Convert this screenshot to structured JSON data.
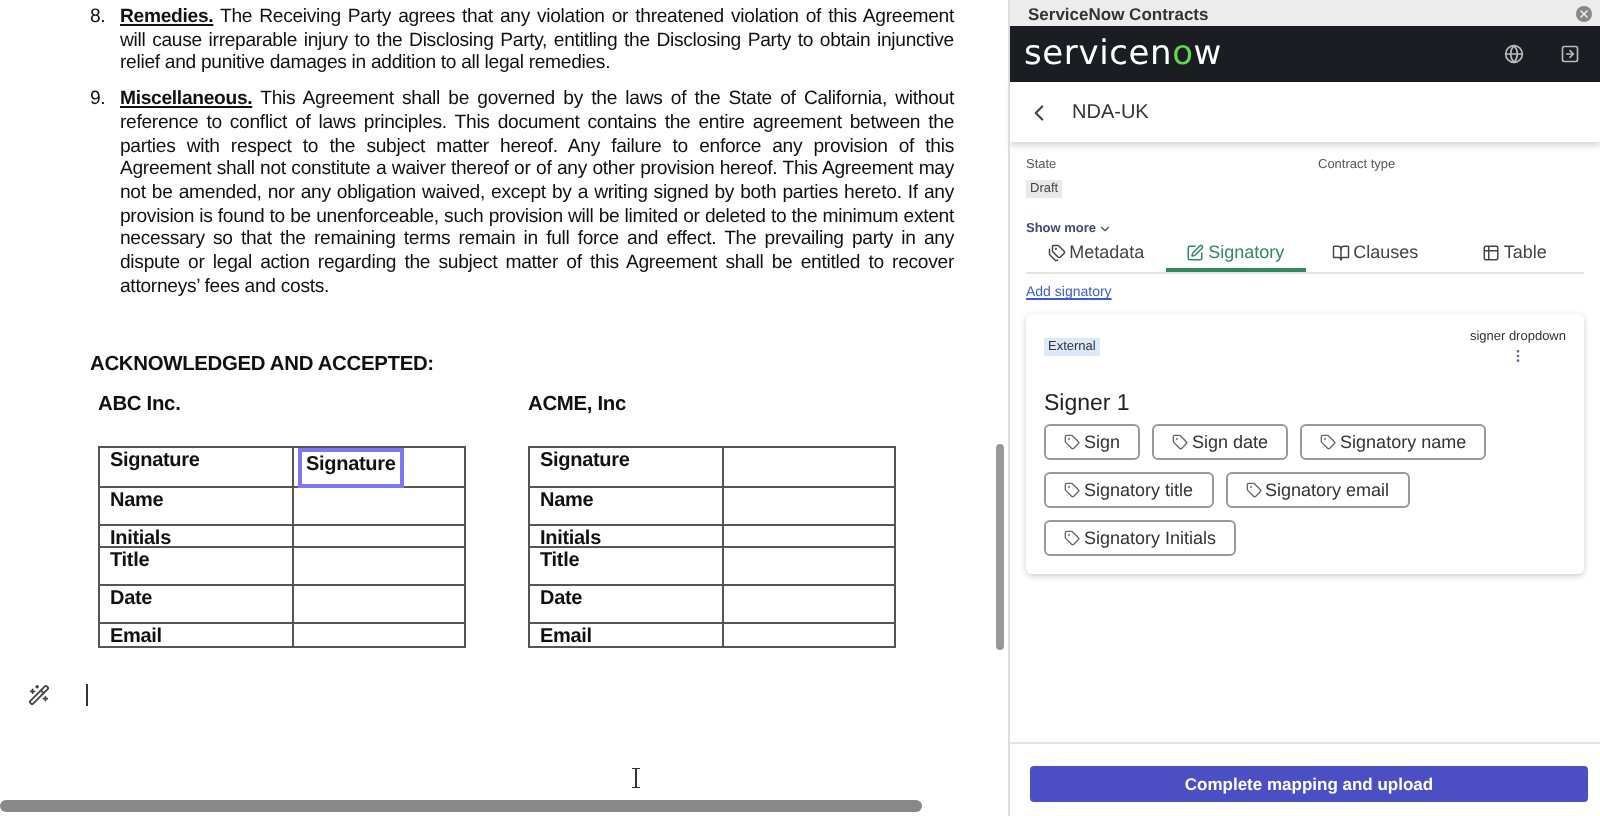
{
  "document": {
    "clauses": [
      {
        "number": "8.",
        "heading": "Remedies.",
        "text": "The Receiving Party agrees that any violation or threatened violation of this Agreement will cause irreparable injury to the Disclosing Party, entitling the Disclosing Party to obtain injunctive relief and punitive damages in addition to all legal remedies."
      },
      {
        "number": "9.",
        "heading": "Miscellaneous.",
        "text": "This Agreement shall be governed by the laws of the State of California, without reference to conflict of laws principles.  This document contains the entire agreement between the parties with respect to the subject matter hereof.  Any failure to enforce any provision of this Agreement shall not constitute a waiver thereof or of any other provision hereof.  This Agreement may not be amended, nor any obligation waived, except by a writing signed by both parties hereto. If any provision is found to be unenforceable, such provision will be limited or deleted to the minimum extent necessary so that the remaining terms remain in full force and effect. The prevailing party in any dispute or legal action regarding the subject matter of this Agreement shall be entitled to recover attorneys’ fees and costs."
      }
    ],
    "acknowledgement": "ACKNOWLEDGED AND ACCEPTED:",
    "parties": [
      {
        "name": "ABC Inc.",
        "rows": [
          {
            "label": "Signature",
            "value": {
              "text": "Signature",
              "selected": true
            }
          },
          {
            "label": "Name"
          },
          {
            "label": "Initials"
          },
          {
            "label": "Title"
          },
          {
            "label": "Date"
          },
          {
            "label": "Email"
          }
        ]
      },
      {
        "name": "ACME, Inc",
        "rows": [
          {
            "label": "Signature"
          },
          {
            "label": "Name"
          },
          {
            "label": "Initials"
          },
          {
            "label": "Title"
          },
          {
            "label": "Date"
          },
          {
            "label": "Email"
          }
        ]
      }
    ]
  },
  "panel": {
    "window_title": "ServiceNow Contracts",
    "logo": {
      "text_a": "servicen",
      "text_o": "o",
      "text_b": "w"
    },
    "record": "NDA-UK",
    "fields": [
      {
        "label": "State",
        "value": "Draft"
      },
      {
        "label": "Contract type"
      }
    ],
    "show_more": "Show more",
    "tabs": [
      {
        "label": "Metadata",
        "selected": false
      },
      {
        "label": "Signatory",
        "selected": true
      },
      {
        "label": "Clauses",
        "selected": false
      },
      {
        "label": "Table",
        "selected": false
      }
    ],
    "add_link": "Add signatory",
    "signer": {
      "badge": "External",
      "dropdown_label": "signer dropdown",
      "title": "Signer 1",
      "tags": [
        "Sign",
        "Sign date",
        "Signatory name",
        "Signatory title",
        "Signatory email",
        "Signatory Initials"
      ]
    },
    "primary_button": "Complete mapping and upload"
  }
}
